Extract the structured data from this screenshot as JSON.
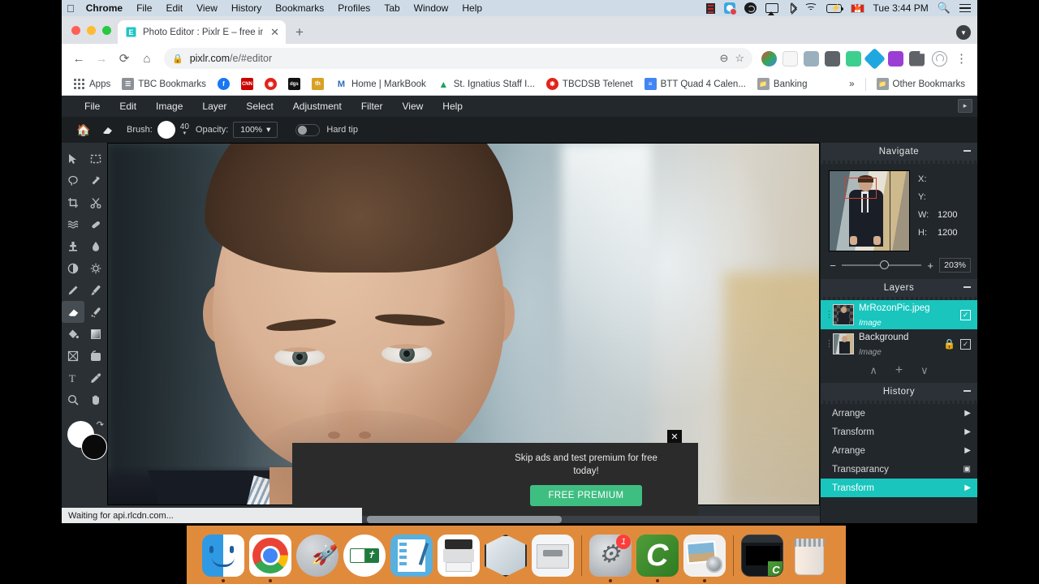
{
  "macos_menubar": {
    "apple_icon": "apple-icon",
    "items": [
      {
        "label": "Chrome",
        "bold": true
      },
      {
        "label": "File",
        "bold": false
      },
      {
        "label": "Edit",
        "bold": false
      },
      {
        "label": "View",
        "bold": false
      },
      {
        "label": "History",
        "bold": false
      },
      {
        "label": "Bookmarks",
        "bold": false
      },
      {
        "label": "Profiles",
        "bold": false
      },
      {
        "label": "Tab",
        "bold": false
      },
      {
        "label": "Window",
        "bold": false
      },
      {
        "label": "Help",
        "bold": false
      }
    ],
    "tray": {
      "icons": [
        "film-strip-icon",
        "screen-recorder-icon",
        "creative-cloud-icon",
        "airplay-icon",
        "bluetooth-icon",
        "wifi-icon",
        "battery-charging-icon",
        "canada-flag-icon"
      ],
      "time": "Tue 3:44 PM",
      "search_icon": "spotlight-search-icon",
      "control_center_icon": "control-center-icon"
    }
  },
  "browser": {
    "window_controls": [
      "close",
      "minimize",
      "maximize"
    ],
    "tab": {
      "favicon_letter": "E",
      "title": "Photo Editor : Pixlr E – free ima",
      "close_label": "✕"
    },
    "new_tab_label": "+",
    "tab_list_chevron": "▼",
    "nav": {
      "back": "←",
      "forward": "→",
      "reload": "⟳",
      "home": "⌂"
    },
    "omnibox": {
      "lock_icon": "lock-icon",
      "url_host": "pixlr.com",
      "url_path": "/e/#editor",
      "zoom_out_icon": "zoom-out-icon",
      "bookmark_icon": "star-icon"
    },
    "extensions": [
      {
        "name": "grammarly-extension",
        "color": "#f0f2f4"
      },
      {
        "name": "kami-extension",
        "color": "#f6f6f6"
      },
      {
        "name": "adobe-acrobat-extension",
        "color": "#b6c2cb"
      },
      {
        "name": "d-extension",
        "color": "#5f6368"
      },
      {
        "name": "screencastify-extension",
        "color": "#3dcf8e"
      },
      {
        "name": "diamond-extension",
        "color": "#21a7e0"
      },
      {
        "name": "markbook-extension",
        "color": "#9b3fd4"
      },
      {
        "name": "puzzle-extension",
        "color": "#5f6368"
      }
    ],
    "profile_icon": "profile-avatar-icon",
    "menu_icon": "three-dots-menu-icon",
    "bookmarks": [
      {
        "label": "Apps",
        "icon": "apps-grid-icon",
        "color": "#5f6368"
      },
      {
        "label": "TBC Bookmarks",
        "icon": "folder-list-icon",
        "color": "#7b8186"
      },
      {
        "label": "",
        "icon": "facebook-icon",
        "color": "#1877f2"
      },
      {
        "label": "",
        "icon": "cnn-icon",
        "color": "#cc0000"
      },
      {
        "label": "",
        "icon": "cbc-icon",
        "color": "#e2231a"
      },
      {
        "label": "",
        "icon": "dgs-icon",
        "color": "#111111"
      },
      {
        "label": "",
        "icon": "tb-icon",
        "color": "#d8a126"
      },
      {
        "label": "Home | MarkBook",
        "icon": "markbook-icon",
        "color": "#2b6cb8"
      },
      {
        "label": "St. Ignatius Staff I...",
        "icon": "google-drive-icon",
        "color": "#1aa260"
      },
      {
        "label": "TBCDSB Telenet",
        "icon": "telenet-icon",
        "color": "#e2231a"
      },
      {
        "label": "BTT Quad 4 Calen...",
        "icon": "calendar-doc-icon",
        "color": "#4285f4"
      },
      {
        "label": "Banking",
        "icon": "folder-icon",
        "color": "#9aa0a6"
      }
    ],
    "overflow_label": "»",
    "other_bookmarks": {
      "label": "Other Bookmarks",
      "icon": "folder-icon"
    },
    "status_text": "Waiting for api.rlcdn.com..."
  },
  "pixlr": {
    "menu": [
      "File",
      "Edit",
      "Image",
      "Layer",
      "Select",
      "Adjustment",
      "Filter",
      "Help",
      "View"
    ],
    "menu_items": [
      {
        "label": "File"
      },
      {
        "label": "Edit"
      },
      {
        "label": "Image"
      },
      {
        "label": "Layer"
      },
      {
        "label": "Select"
      },
      {
        "label": "Adjustment"
      },
      {
        "label": "Filter"
      },
      {
        "label": "View"
      },
      {
        "label": "Help"
      }
    ],
    "panel_toggle_icon": "panel-expand-icon",
    "options_bar": {
      "home_icon": "home-icon",
      "tool_icon": "eraser-icon",
      "brush_label": "Brush:",
      "brush_size": "40",
      "opacity_label": "Opacity:",
      "opacity_value": "100%",
      "opacity_caret": "▾",
      "hard_tip_label": "Hard tip",
      "hard_tip_on": false
    },
    "tools": [
      {
        "name": "arrange-tool",
        "icon": "cursor-arrow-icon",
        "selected": false
      },
      {
        "name": "marquee-select-tool",
        "icon": "marquee-select-icon",
        "selected": false
      },
      {
        "name": "lasso-select-tool",
        "icon": "lasso-icon",
        "selected": false
      },
      {
        "name": "magic-wand-tool",
        "icon": "magic-wand-icon",
        "selected": false
      },
      {
        "name": "crop-tool",
        "icon": "crop-icon",
        "selected": false
      },
      {
        "name": "cutout-tool",
        "icon": "scissors-icon",
        "selected": false
      },
      {
        "name": "liquify-tool",
        "icon": "liquify-waves-icon",
        "selected": false
      },
      {
        "name": "heal-tool",
        "icon": "bandage-heal-icon",
        "selected": false
      },
      {
        "name": "clone-stamp-tool",
        "icon": "clone-stamp-icon",
        "selected": false
      },
      {
        "name": "detail-tool",
        "icon": "water-drop-icon",
        "selected": false
      },
      {
        "name": "toning-tool",
        "icon": "dodge-burn-circle-icon",
        "selected": false
      },
      {
        "name": "focus-tool",
        "icon": "sun-focus-icon",
        "selected": false
      },
      {
        "name": "pen-draw-tool",
        "icon": "pencil-icon",
        "selected": false
      },
      {
        "name": "brush-tool",
        "icon": "paintbrush-icon",
        "selected": false
      },
      {
        "name": "eraser-tool",
        "icon": "eraser-icon",
        "selected": true
      },
      {
        "name": "replace-color-tool",
        "icon": "color-replace-brush-icon",
        "selected": false
      },
      {
        "name": "fill-tool",
        "icon": "paint-bucket-icon",
        "selected": false
      },
      {
        "name": "gradient-tool",
        "icon": "gradient-square-icon",
        "selected": false
      },
      {
        "name": "shape-tool",
        "icon": "shape-icon",
        "selected": false
      },
      {
        "name": "draw-tool",
        "icon": "rounded-shape-icon",
        "selected": false
      },
      {
        "name": "text-tool",
        "icon": "text-t-icon",
        "selected": false
      },
      {
        "name": "color-picker-tool",
        "icon": "eyedropper-icon",
        "selected": false
      },
      {
        "name": "zoom-tool",
        "icon": "magnifier-icon",
        "selected": false
      },
      {
        "name": "hand-pan-tool",
        "icon": "hand-icon",
        "selected": false
      }
    ],
    "swatches": {
      "foreground": "#ffffff",
      "background": "#0a0a0a",
      "swap_icon": "swap-colors-icon"
    },
    "ad": {
      "text": "Skip ads and test premium for free today!",
      "button_label": "FREE PREMIUM",
      "close_label": "✕",
      "button_color": "#3fbe82"
    },
    "navigate": {
      "title": "Navigate",
      "minimize_icon": "minimize-icon",
      "x_label": "X:",
      "x_value": "",
      "y_label": "Y:",
      "y_value": "",
      "w_label": "W:",
      "w_value": "1200",
      "h_label": "H:",
      "h_value": "1200",
      "zoom_out_label": "−",
      "zoom_in_label": "+",
      "zoom_value": "203%"
    },
    "layers": {
      "title": "Layers",
      "minimize_icon": "minimize-icon",
      "items": [
        {
          "name": "MrRozonPic.jpeg",
          "type": "Image",
          "selected": true,
          "locked": false,
          "visible": true
        },
        {
          "name": "Background",
          "type": "Image",
          "selected": false,
          "locked": true,
          "visible": true
        }
      ],
      "actions": [
        {
          "name": "move-layer-up-button",
          "icon": "chevron-up-icon",
          "label": "∧"
        },
        {
          "name": "add-layer-button",
          "icon": "plus-icon",
          "label": "+"
        },
        {
          "name": "move-layer-down-button",
          "icon": "chevron-down-icon",
          "label": "∨"
        }
      ]
    },
    "history": {
      "title": "History",
      "minimize_icon": "minimize-icon",
      "items": [
        {
          "label": "Arrange",
          "icon": "arrange-flag-icon",
          "selected": false
        },
        {
          "label": "Transform",
          "icon": "arrange-flag-icon",
          "selected": false
        },
        {
          "label": "Arrange",
          "icon": "arrange-flag-icon",
          "selected": false
        },
        {
          "label": "Transparancy",
          "icon": "layers-doc-icon",
          "selected": false
        },
        {
          "label": "Transform",
          "icon": "arrange-flag-icon",
          "selected": true
        }
      ]
    },
    "accent_color": "#19c5bd"
  },
  "dock": {
    "items": [
      {
        "name": "finder",
        "running": true
      },
      {
        "name": "google-chrome",
        "running": true
      },
      {
        "name": "launchpad",
        "running": false
      },
      {
        "name": "bible-app",
        "running": false
      },
      {
        "name": "notes-app",
        "running": false
      },
      {
        "name": "printer-app",
        "running": false
      },
      {
        "name": "cube-app",
        "running": false
      },
      {
        "name": "printer-driver-app",
        "running": false
      },
      {
        "name": "system-preferences",
        "running": true,
        "badge": "1"
      },
      {
        "name": "camtasia",
        "running": true
      },
      {
        "name": "preview-photos",
        "running": true
      },
      {
        "name": "recording-window",
        "running": false
      },
      {
        "name": "trash",
        "running": false
      }
    ]
  }
}
